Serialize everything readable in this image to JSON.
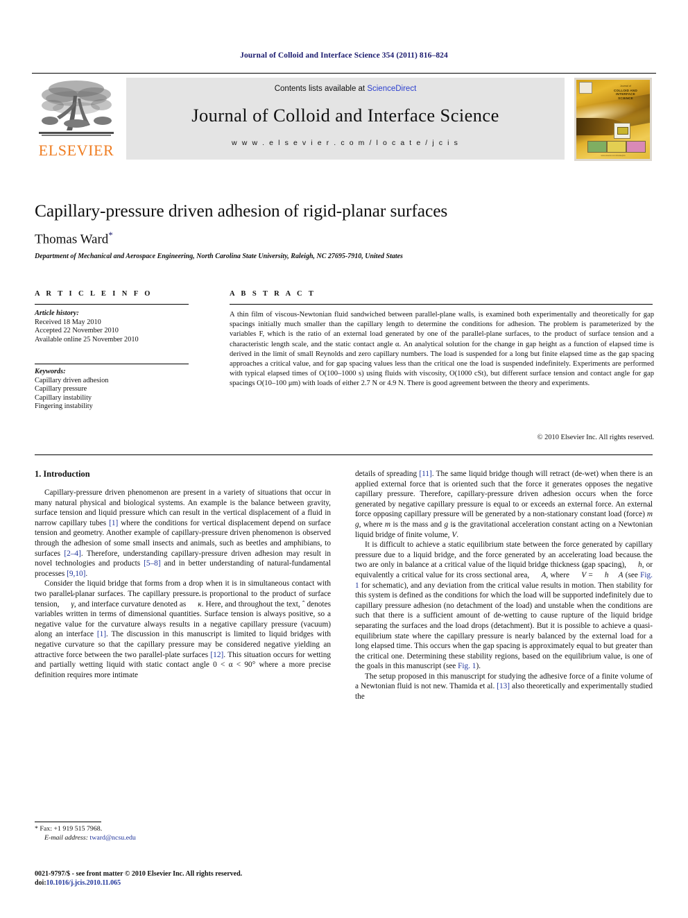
{
  "running_head": "Journal of Colloid and Interface Science 354 (2011) 816–824",
  "masthead": {
    "contents_prefix": "Contents lists available at ",
    "sciencedirect": "ScienceDirect",
    "journal_title": "Journal of Colloid and Interface Science",
    "homepage_url": "w w w . e l s e v i e r . c o m / l o c a t e / j c i s",
    "publisher": "ELSEVIER",
    "cover": {
      "journal_of": "Journal of",
      "line1": "COLLOID AND",
      "line2": "INTERFACE",
      "line3": "SCIENCE",
      "footer": "www.elsevier.com/locate/jcis"
    }
  },
  "article": {
    "title": "Capillary-pressure driven adhesion of rigid-planar surfaces",
    "author": "Thomas Ward",
    "author_marker": "*",
    "affiliation": "Department of Mechanical and Aerospace Engineering, North Carolina State University, Raleigh, NC 27695-7910, United States"
  },
  "info": {
    "heading": "A R T I C L E   I N F O",
    "history_label": "Article history:",
    "history": [
      "Received 18 May 2010",
      "Accepted 22 November 2010",
      "Available online 25 November 2010"
    ],
    "keywords_label": "Keywords:",
    "keywords": [
      "Capillary driven adhesion",
      "Capillary pressure",
      "Capillary instability",
      "Fingering instability"
    ]
  },
  "abstract": {
    "heading": "A B S T R A C T",
    "body": "A thin film of viscous-Newtonian fluid sandwiched between parallel-plane walls, is examined both experimentally and theoretically for gap spacings initially much smaller than the capillary length to determine the conditions for adhesion. The problem is parameterized by the variables F, which is the ratio of an external load generated by one of the parallel-plane surfaces, to the product of surface tension and a characteristic length scale, and the static contact angle α. An analytical solution for the change in gap height as a function of elapsed time is derived in the limit of small Reynolds and zero capillary numbers. The load is suspended for a long but finite elapsed time as the gap spacing approaches a critical value, and for gap spacing values less than the critical one the load is suspended indefinitely. Experiments are performed with typical elapsed times of O(100–1000 s) using fluids with viscosity, O(1000 cSt), but different surface tension and contact angle for gap spacings O(10–100 μm) with loads of either 2.7 N or 4.9 N. There is good agreement between the theory and experiments.",
    "copyright": "© 2010 Elsevier Inc. All rights reserved."
  },
  "body": {
    "section_heading": "1. Introduction",
    "left": {
      "p1_a": "Capillary-pressure driven phenomenon are present in a variety of situations that occur in many natural physical and biological systems. An example is the balance between gravity, surface tension and liquid pressure which can result in the vertical displacement of a fluid in narrow capillary tubes ",
      "p1_ref1": "[1]",
      "p1_b": " where the conditions for vertical displacement depend on surface tension and geometry. Another example of capillary-pressure driven phenomenon is observed through the adhesion of some small insects and animals, such as beetles and amphibians, to surfaces ",
      "p1_ref2": "[2–4]",
      "p1_c": ". Therefore, understanding capillary-pressure driven adhesion may result in novel technologies and products ",
      "p1_ref3": "[5–8]",
      "p1_d": " and in better understanding of natural-fundamental processes ",
      "p1_ref4": "[9,10]",
      "p1_e": ".",
      "p2_a": "Consider the liquid bridge that forms from a drop when it is in simultaneous contact with two parallel-planar surfaces. The capillary pressure is proportional to the product of surface tension, ",
      "p2_var1": "γ",
      "p2_b": ", and interface curvature denoted as ",
      "p2_var2": "κ",
      "p2_c": ". Here, and throughout the text, ",
      "p2_var3": "ˆ",
      "p2_d": " denotes variables written in terms of dimensional quantities. Surface tension is always positive, so a negative value for the curvature always results in a negative capillary pressure (vacuum) along an interface ",
      "p2_ref1": "[1]",
      "p2_e": ". The discussion in this manuscript is limited to liquid bridges with negative curvature so that the capillary pressure may be considered negative yielding an attractive force between the two parallel-plate surfaces ",
      "p2_ref2": "[12]",
      "p2_f": ". This situation occurs for wetting and partially wetting liquid with static contact angle 0 < α < 90° where a more precise definition requires more intimate"
    },
    "right": {
      "p1_a": "details of spreading ",
      "p1_ref1": "[11]",
      "p1_b": ". The same liquid bridge though will retract (de-wet) when there is an applied external force that is oriented such that the force it generates opposes the negative capillary pressure. Therefore, capillary-pressure driven adhesion occurs when the force generated by negative capillary pressure is equal to or exceeds an external force. An external force opposing capillary pressure will be generated by a non-stationary constant load (force) ",
      "p1_var1": "m",
      "p1_var2": "g",
      "p1_c": ", where ",
      "p1_var3": "m",
      "p1_d": " is the mass and ",
      "p1_var4": "g",
      "p1_e": " is the gravitational acceleration constant acting on a Newtonian liquid bridge of finite volume, ",
      "p1_var5": "V",
      "p1_f": ".",
      "p2_a": "It is difficult to achieve a static equilibrium state between the force generated by capillary pressure due to a liquid bridge, and the force generated by an accelerating load because the two are only in balance at a critical value of the liquid bridge thickness (gap spacing), ",
      "p2_var1": "h",
      "p2_b": ", or equivalently a critical value for its cross sectional area, ",
      "p2_var2": "A",
      "p2_c": ", where ",
      "p2_eq_v": "V",
      "p2_eq_eq": " = ",
      "p2_eq_h": "h",
      "p2_eq_a": "A",
      "p2_d": " (see ",
      "p2_fig": "Fig. 1",
      "p2_e": " for schematic), and any deviation from the critical value results in motion. Then stability for this system is defined as the conditions for which the load will be supported indefinitely due to capillary pressure adhesion (no detachment of the load) and unstable when the conditions are such that there is a sufficient amount of de-wetting to cause rupture of the liquid bridge separating the surfaces and the load drops (detachment). But it is possible to achieve a quasi-equilibrium state where the capillary pressure is nearly balanced by the external load for a long elapsed time. This occurs when the gap spacing is approximately equal to but greater than the critical one. Determining these stability regions, based on the equilibrium value, is one of the goals in this manuscript (see ",
      "p2_fig2": "Fig. 1",
      "p2_f": ").",
      "p3_a": "The setup proposed in this manuscript for studying the adhesive force of a finite volume of a Newtonian fluid is not new. Thamida et al. ",
      "p3_ref1": "[13]",
      "p3_b": " also theoretically and experimentally studied the"
    }
  },
  "footnote": {
    "marker": "*",
    "fax": "Fax: +1 919 515 7968.",
    "email_label": "E-mail address:",
    "email": "tward@ncsu.edu"
  },
  "imprint": {
    "line1": "0021-9797/$ - see front matter © 2010 Elsevier Inc. All rights reserved.",
    "doi_label": "doi:",
    "doi": "10.1016/j.jcis.2010.11.065"
  }
}
